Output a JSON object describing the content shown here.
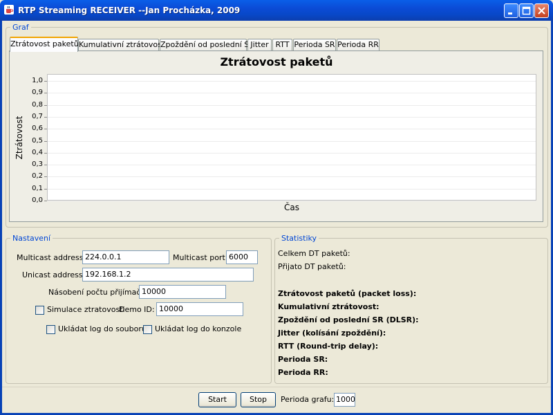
{
  "window": {
    "title": "RTP Streaming RECEIVER --Jan Procházka, 2009"
  },
  "graf": {
    "legend": "Graf",
    "tabs": [
      "Ztrátovost paketů",
      "Kumulativní ztrátovost",
      "Zpoždění od poslední SR",
      "Jitter",
      "RTT",
      "Perioda SR",
      "Perioda RR"
    ],
    "active_tab": 0
  },
  "chart_data": {
    "type": "line",
    "title": "Ztrátovost paketů",
    "xlabel": "Čas",
    "ylabel": "Ztrátovost",
    "ylim": [
      0.0,
      1.0
    ],
    "yticks": [
      "1,0",
      "0,9",
      "0,8",
      "0,7",
      "0,6",
      "0,5",
      "0,4",
      "0,3",
      "0,2",
      "0,1",
      "0,0"
    ],
    "grid": true,
    "series": []
  },
  "nastaveni": {
    "legend": "Nastavení",
    "multicast_address_label": "Multicast address:",
    "multicast_address_value": "224.0.0.1",
    "multicast_port_label": "Multicast port:",
    "multicast_port_value": "6000",
    "unicast_address_label": "Unicast address:",
    "unicast_address_value": "192.168.1.2",
    "nasobeni_label": "Násobení počtu přijímačů:",
    "nasobeni_value": "10000",
    "simulace_label": "Simulace ztratovosti",
    "simulace_checked": false,
    "demo_id_label": "Demo ID:",
    "demo_id_value": "10000",
    "log_soubor_label": "Ukládat log do souboru",
    "log_soubor_checked": false,
    "log_konzole_label": "Ukládat log do konzole",
    "log_konzole_checked": false
  },
  "statistiky": {
    "legend": "Statistiky",
    "celkem_dt": "Celkem DT paketů:",
    "prijato_dt": "Přijato DT paketů:",
    "ztratovost": "Ztrátovost paketů (packet loss):",
    "kumulativni": "Kumulativní ztrátovost:",
    "zpozdeni": "Zpoždění od poslední SR (DLSR):",
    "jitter": "Jitter (kolísání zpoždění):",
    "rtt": "RTT (Round-trip delay):",
    "perioda_sr": "Perioda SR:",
    "perioda_rr": "Perioda RR:"
  },
  "bottom": {
    "start_label": "Start",
    "stop_label": "Stop",
    "perioda_grafu_label": "Perioda grafu:",
    "perioda_grafu_value": "1000"
  },
  "colors": {
    "titlebar": "#0a5fe8",
    "legend_text": "#0046d5",
    "background": "#ece9d8"
  }
}
